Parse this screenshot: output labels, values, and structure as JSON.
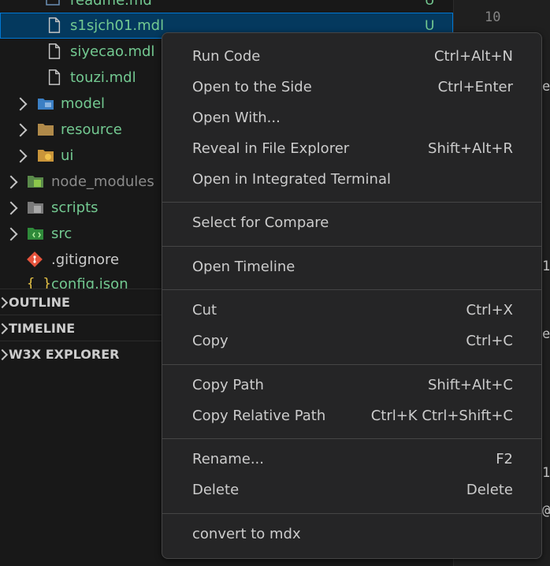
{
  "explorer": {
    "files": [
      {
        "label": "readme.md",
        "badge": "U"
      },
      {
        "label": "s1sjch01.mdl",
        "badge": "U"
      },
      {
        "label": "siyecao.mdl"
      },
      {
        "label": "touzi.mdl"
      }
    ],
    "folders": [
      {
        "label": "model"
      },
      {
        "label": "resource"
      },
      {
        "label": "ui"
      },
      {
        "label": "node_modules"
      },
      {
        "label": "scripts"
      },
      {
        "label": "src"
      }
    ],
    "gitignore": ".gitignore",
    "config": "config.json",
    "json_icon": "{ }",
    "sections": [
      "OUTLINE",
      "TIMELINE",
      "W3X EXPLORER"
    ]
  },
  "editor": {
    "line_number": "10",
    "edge_chars": [
      "e",
      "1",
      "e",
      "1",
      "@"
    ]
  },
  "context_menu": {
    "groups": [
      [
        {
          "label": "Run Code",
          "shortcut": "Ctrl+Alt+N"
        },
        {
          "label": "Open to the Side",
          "shortcut": "Ctrl+Enter"
        },
        {
          "label": "Open With...",
          "shortcut": ""
        },
        {
          "label": "Reveal in File Explorer",
          "shortcut": "Shift+Alt+R"
        },
        {
          "label": "Open in Integrated Terminal",
          "shortcut": ""
        }
      ],
      [
        {
          "label": "Select for Compare",
          "shortcut": ""
        }
      ],
      [
        {
          "label": "Open Timeline",
          "shortcut": ""
        }
      ],
      [
        {
          "label": "Cut",
          "shortcut": "Ctrl+X"
        },
        {
          "label": "Copy",
          "shortcut": "Ctrl+C"
        }
      ],
      [
        {
          "label": "Copy Path",
          "shortcut": "Shift+Alt+C"
        },
        {
          "label": "Copy Relative Path",
          "shortcut": "Ctrl+K Ctrl+Shift+C"
        }
      ],
      [
        {
          "label": "Rename...",
          "shortcut": "F2"
        },
        {
          "label": "Delete",
          "shortcut": "Delete"
        }
      ],
      [
        {
          "label": "convert to mdx",
          "shortcut": ""
        }
      ]
    ]
  },
  "colors": {
    "accent": "#0078d4",
    "git_untracked": "#73c991",
    "menu_bg": "#252526"
  }
}
